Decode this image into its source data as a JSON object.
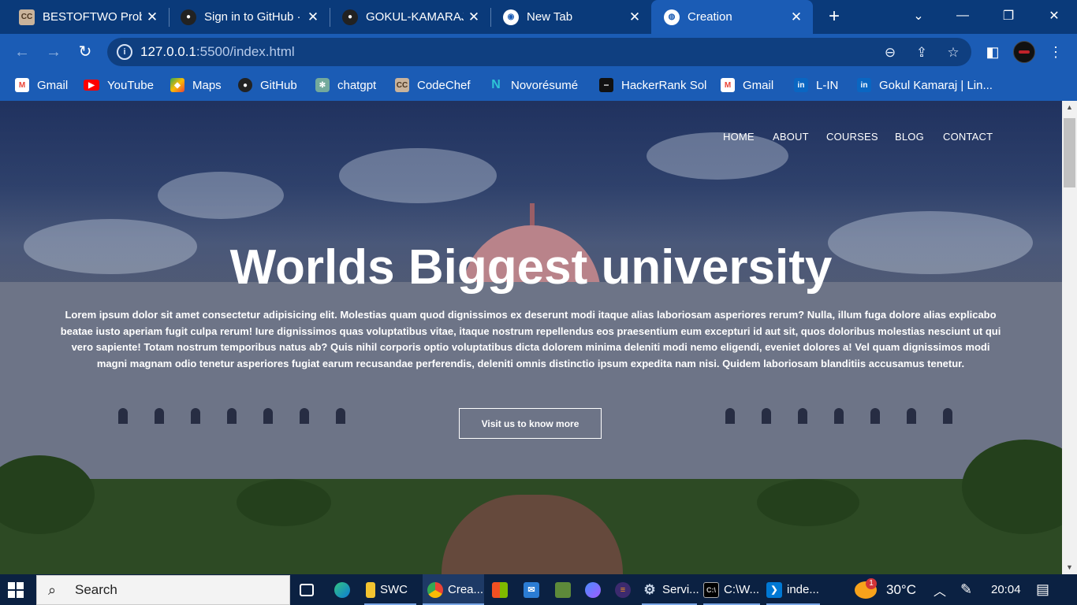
{
  "browser": {
    "tabs": [
      {
        "title": "BESTOFTWO Probl",
        "favicon": "codechef-icon",
        "active": false
      },
      {
        "title": "Sign in to GitHub ·",
        "favicon": "github-icon",
        "active": false
      },
      {
        "title": "GOKUL-KAMARAJ/",
        "favicon": "github-icon",
        "active": false
      },
      {
        "title": "New Tab",
        "favicon": "chrome-icon",
        "active": false
      },
      {
        "title": "Creation",
        "favicon": "globe-icon",
        "active": true
      }
    ],
    "url_host": "127.0.0.1",
    "url_rest": ":5500/index.html",
    "bookmarks": [
      {
        "label": "Gmail",
        "icon": "gmail-icon"
      },
      {
        "label": "YouTube",
        "icon": "youtube-icon"
      },
      {
        "label": "Maps",
        "icon": "maps-icon"
      },
      {
        "label": "GitHub",
        "icon": "github-icon"
      },
      {
        "label": "chatgpt",
        "icon": "chatgpt-icon"
      },
      {
        "label": "CodeChef",
        "icon": "codechef-icon"
      },
      {
        "label": "Novorésumé",
        "icon": "novoresume-icon"
      },
      {
        "label": "HackerRank Sol",
        "icon": "hackerrank-icon"
      },
      {
        "label": "Gmail",
        "icon": "gmail-icon"
      },
      {
        "label": "L-IN",
        "icon": "linkedin-icon"
      },
      {
        "label": "Gokul Kamaraj | Lin...",
        "icon": "linkedin-icon"
      }
    ],
    "colors": {
      "tabbar": "#0a3a7a",
      "toolbar": "#1b5cb5"
    }
  },
  "site": {
    "nav": [
      "HOME",
      "ABOUT",
      "COURSES",
      "BLOG",
      "CONTACT"
    ],
    "hero_title": "Worlds Biggest university",
    "hero_text": "Lorem ipsum dolor sit amet consectetur adipisicing elit. Molestias quam quod dignissimos ex deserunt modi itaque alias laboriosam asperiores rerum? Nulla, illum fuga dolore alias explicabo beatae iusto aperiam fugit culpa rerum! Iure dignissimos quas voluptatibus vitae, itaque nostrum repellendus eos praesentium eum excepturi id aut sit, quos doloribus molestias nesciunt ut qui vero sapiente! Totam nostrum temporibus natus ab? Quis nihil corporis optio voluptatibus dicta dolorem minima deleniti modi nemo eligendi, eveniet dolores a! Vel quam dignissimos modi magni magnam odio tenetur asperiores fugiat earum recusandae perferendis, deleniti omnis distinctio ipsum expedita nam nisi. Quidem laboriosam blanditiis accusamus tenetur.",
    "cta_label": "Visit us to know more"
  },
  "taskbar": {
    "search_label": "Search",
    "apps": [
      {
        "label": "",
        "icon": "task-view-icon"
      },
      {
        "label": "",
        "icon": "edge-icon"
      },
      {
        "label": "SWC",
        "icon": "folder-icon"
      },
      {
        "label": "Crea...",
        "icon": "chrome-icon"
      },
      {
        "label": "",
        "icon": "store-icon"
      },
      {
        "label": "",
        "icon": "mail-icon"
      },
      {
        "label": "",
        "icon": "minecraft-icon"
      },
      {
        "label": "",
        "icon": "copilot-icon"
      },
      {
        "label": "",
        "icon": "eclipse-icon"
      },
      {
        "label": "Servi...",
        "icon": "gear-icon"
      },
      {
        "label": "C:\\W...",
        "icon": "terminal-icon"
      },
      {
        "label": "inde...",
        "icon": "vscode-icon"
      }
    ],
    "weather_badge": "1",
    "temperature": "30°C",
    "time": "20:04"
  }
}
